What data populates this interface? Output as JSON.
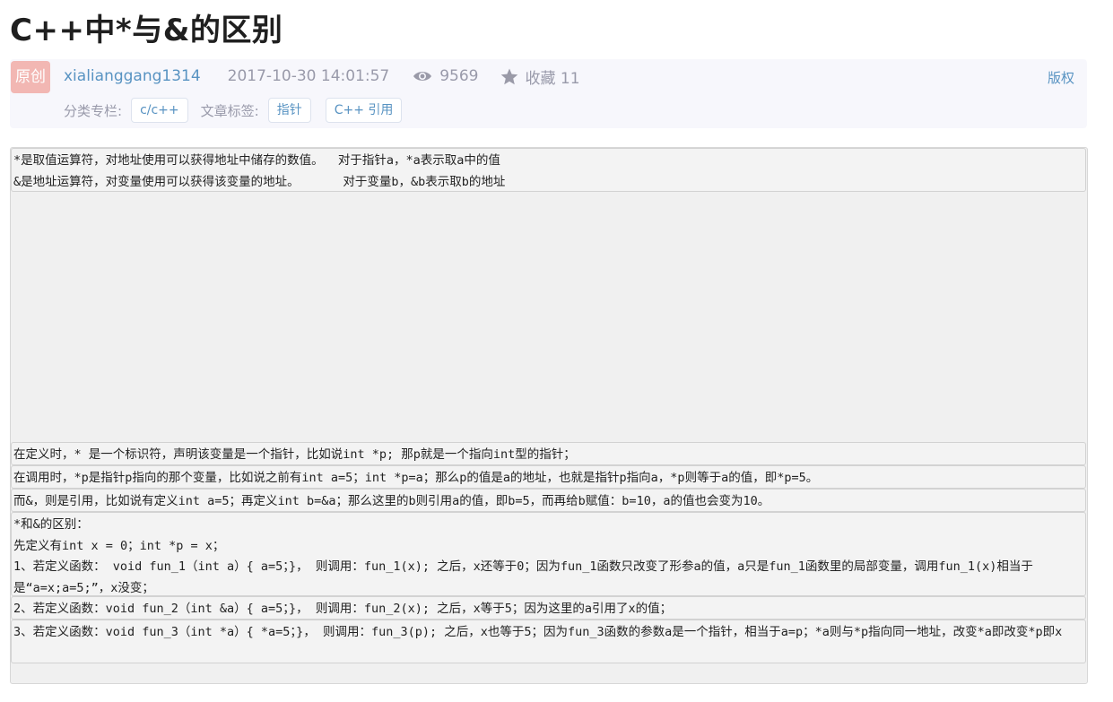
{
  "article": {
    "title": "C++中*与&的区别",
    "badge": "原创",
    "author": "xialianggang1314",
    "date": "2017-10-30 14:01:57",
    "views": "9569",
    "favorites": "收藏 11",
    "copyright": "版权",
    "category_label": "分类专栏:",
    "category": "c/c++",
    "tags_label": "文章标签:",
    "tags": [
      "指针",
      "C++ 引用"
    ]
  },
  "content": {
    "blocks": [
      "*是取值运算符，对地址使用可以获得地址中储存的数值。  对于指针a，*a表示取a中的值\n&是地址运算符，对变量使用可以获得该变量的地址。      对于变量b，&b表示取b的地址",
      "在定义时，* 是一个标识符，声明该变量是一个指针，比如说int *p; 那p就是一个指向int型的指针；",
      "在调用时，*p是指针p指向的那个变量，比如说之前有int a=5；int *p=a；那么p的值是a的地址，也就是指针p指向a，*p则等于a的值，即*p=5。",
      "而&，则是引用，比如说有定义int a=5；再定义int b=&a；那么这里的b则引用a的值，即b=5，而再给b赋值：b=10，a的值也会变为10。",
      "*和&的区别：\n先定义有int x = 0；int *p = x；\n1、若定义函数： void fun_1（int a）{ a=5；}， 则调用：fun_1(x); 之后，x还等于0；因为fun_1函数只改变了形参a的值，a只是fun_1函数里的局部变量，调用fun_1(x)相当于是“a=x;a=5;”，x没变；",
      "2、若定义函数：void fun_2（int &a）{ a=5；}， 则调用：fun_2(x); 之后，x等于5；因为这里的a引用了x的值；",
      "3、若定义函数：void fun_3（int *a）{ *a=5；}， 则调用：fun_3(p); 之后，x也等于5；因为fun_3函数的参数a是一个指针，相当于a=p；*a则与*p指向同一地址，改变*a即改变*p即x"
    ]
  },
  "colors": {
    "badge_bg": "#f2b7b3",
    "link": "#5893c2",
    "muted": "#999aaa",
    "meta_bg": "#f7f7fc"
  }
}
